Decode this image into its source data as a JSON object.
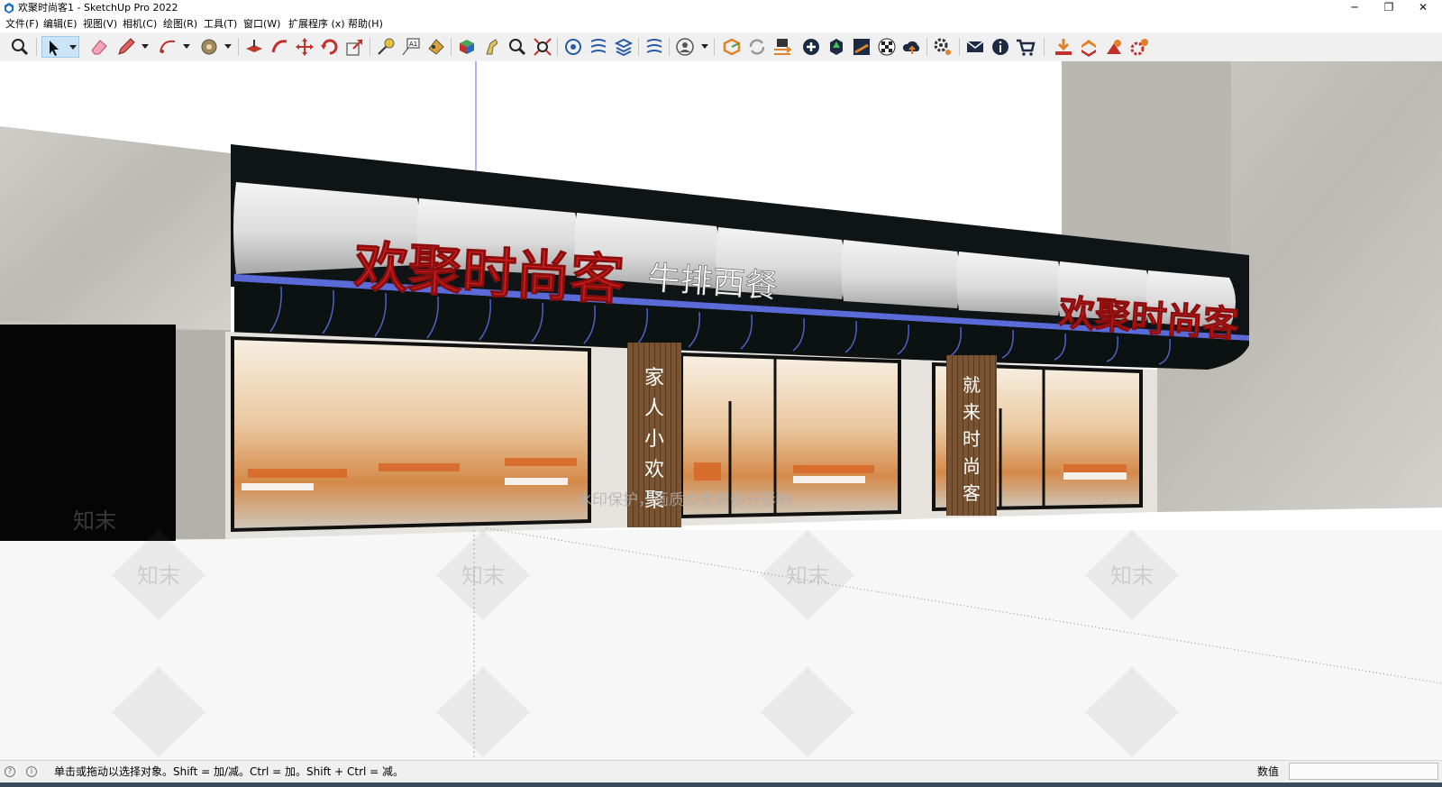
{
  "window": {
    "title": "欢聚时尚客1 - SketchUp Pro 2022",
    "minimize": "─",
    "restore": "❐",
    "close": "✕"
  },
  "menu": [
    "文件(F)",
    "编辑(E)",
    "视图(V)",
    "相机(C)",
    "绘图(R)",
    "工具(T)",
    "窗口(W)",
    "扩展程序 (x)",
    "帮助(H)"
  ],
  "toolbar": {
    "icons": [
      "zoom-window-icon",
      "select-arrow-icon",
      "eraser-icon",
      "pencil-line-icon",
      "arc-icon",
      "paint-bucket-icon",
      "push-pull-icon",
      "follow-me-icon",
      "move-icon",
      "rotate-icon",
      "scale-icon",
      "tape-measure-icon",
      "text-label-icon",
      "paint-icon",
      "section-plane-icon",
      "walk-icon",
      "look-around-icon",
      "zoom-extents-icon",
      "extension-1-icon",
      "extension-2-icon",
      "extension-3-icon",
      "extension-4-icon",
      "account-icon",
      "warehouse-icon",
      "refresh-icon",
      "swap-icon",
      "add-icon",
      "tree-icon",
      "layers-icon",
      "checker-icon",
      "cloud-upload-icon",
      "settings-icon",
      "mail-icon",
      "info-icon",
      "cart-icon",
      "import-icon",
      "export-icon",
      "plugin-a-icon",
      "plugin-b-icon"
    ]
  },
  "scene": {
    "sign_main_left": "欢聚时尚客",
    "sign_sub": "牛排西餐",
    "sign_main_right": "欢聚时尚客",
    "pillar_left_chars": [
      "家",
      "人",
      "小",
      "欢",
      "聚"
    ],
    "pillar_right_chars": [
      "就",
      "来",
      "时",
      "尚",
      "客"
    ],
    "watermark_text": "知末",
    "watermark_notice": "水印保护，画质会受到部分影响"
  },
  "status": {
    "hint": "单击或拖动以选择对象。Shift = 加/减。Ctrl = 加。Shift + Ctrl = 减。",
    "measure_label": "数值",
    "measure_value": ""
  },
  "colors": {
    "sign_red": "#d21e1e",
    "fascia_dark": "#0f1516",
    "accent_blue": "#5a6bd8",
    "wood_pillar": "#7a5330"
  }
}
